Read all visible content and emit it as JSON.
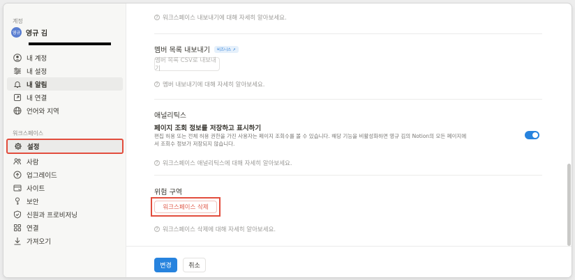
{
  "sidebar": {
    "account_label": "계정",
    "user_name": "영규 김",
    "avatar_text": "영규",
    "account_items": [
      {
        "label": "내 계정",
        "icon": "user-circle-icon"
      },
      {
        "label": "내 설정",
        "icon": "sliders-icon"
      },
      {
        "label": "내 알림",
        "icon": "bell-icon"
      },
      {
        "label": "내 연결",
        "icon": "external-link-icon"
      },
      {
        "label": "언어와 지역",
        "icon": "globe-icon"
      }
    ],
    "workspace_label": "워크스페이스",
    "workspace_items": [
      {
        "label": "설정",
        "icon": "gear-icon"
      },
      {
        "label": "사람",
        "icon": "people-icon"
      },
      {
        "label": "업그레이드",
        "icon": "upgrade-icon"
      },
      {
        "label": "사이트",
        "icon": "site-icon"
      },
      {
        "label": "보안",
        "icon": "key-icon"
      },
      {
        "label": "신원과 프로비저닝",
        "icon": "shield-check-icon"
      },
      {
        "label": "연결",
        "icon": "grid-icon"
      },
      {
        "label": "가져오기",
        "icon": "download-icon"
      }
    ]
  },
  "main": {
    "export_help": "워크스페이스 내보내기에 대해 자세히 알아보세요.",
    "member_export": {
      "title": "멤버 목록 내보내기",
      "badge": "비즈니스 ↗",
      "button": "멤버 목록 CSV로 내보내기",
      "help": "멤버 내보내기에 대해 자세히 알아보세요."
    },
    "analytics": {
      "title": "애널리틱스",
      "subtitle": "페이지 조회 정보를 저장하고 표시하기",
      "desc_line1": "편집 허용 또는 전체 허용 권한을 가진 사용자는 페이지 조회수를 볼 수 있습니다. 해당 기능을 비활성화하면 영규 김의 Notion의 모든 페이지에",
      "desc_line2": "서 조회수 정보가 저장되지 않습니다.",
      "toggle_on": true,
      "help": "워크스페이스 애널리틱스에 대해 자세히 알아보세요."
    },
    "danger": {
      "title": "위험 구역",
      "button": "워크스페이스 삭제",
      "help": "워크스페이스 삭제에 대해 자세히 알아보세요."
    }
  },
  "footer": {
    "save_label": "변경",
    "cancel_label": "취소"
  }
}
